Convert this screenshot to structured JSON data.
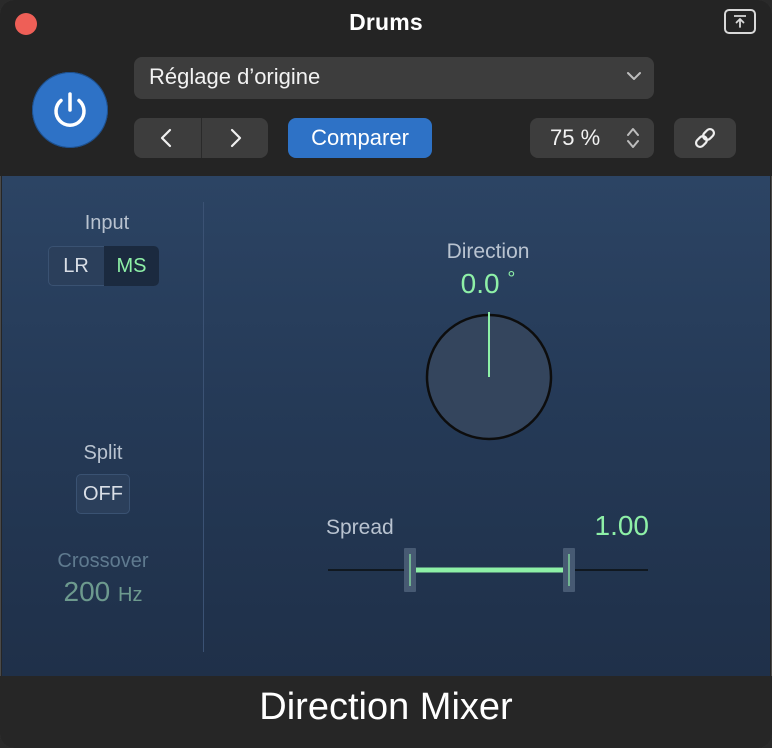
{
  "window": {
    "title": "Drums",
    "plugin_name": "Direction Mixer"
  },
  "header": {
    "power": {
      "icon": "power-icon",
      "state": "on",
      "color": "#2e72c6"
    },
    "preset": {
      "selected": "Réglage d’origine",
      "icon": "chevron-down-icon"
    },
    "compare_label": "Comparer",
    "zoom": {
      "selected": "75 %",
      "icon": "up-down-chevron-icon"
    },
    "link_icon": "link-icon",
    "prev_icon": "chevron-left-icon",
    "next_icon": "chevron-right-icon",
    "collapse_icon": "collapse-icon"
  },
  "controls": {
    "input": {
      "label": "Input",
      "options": [
        "LR",
        "MS"
      ],
      "selected": "MS"
    },
    "split": {
      "label": "Split",
      "value": "OFF"
    },
    "crossover": {
      "label": "Crossover",
      "value": "200",
      "unit": "Hz",
      "enabled": false
    },
    "direction": {
      "label": "Direction",
      "value": "0.0",
      "unit": "°",
      "angle_degrees": 0
    },
    "spread": {
      "label": "Spread",
      "value": "1.00",
      "range": [
        0,
        2
      ],
      "current": 1.0
    }
  },
  "colors": {
    "accent_blue": "#2e72c6",
    "value_green": "#8ef0a7",
    "panel_top": "#2c4464",
    "panel_bottom": "#1f3049",
    "close_red": "#ee5f57"
  }
}
